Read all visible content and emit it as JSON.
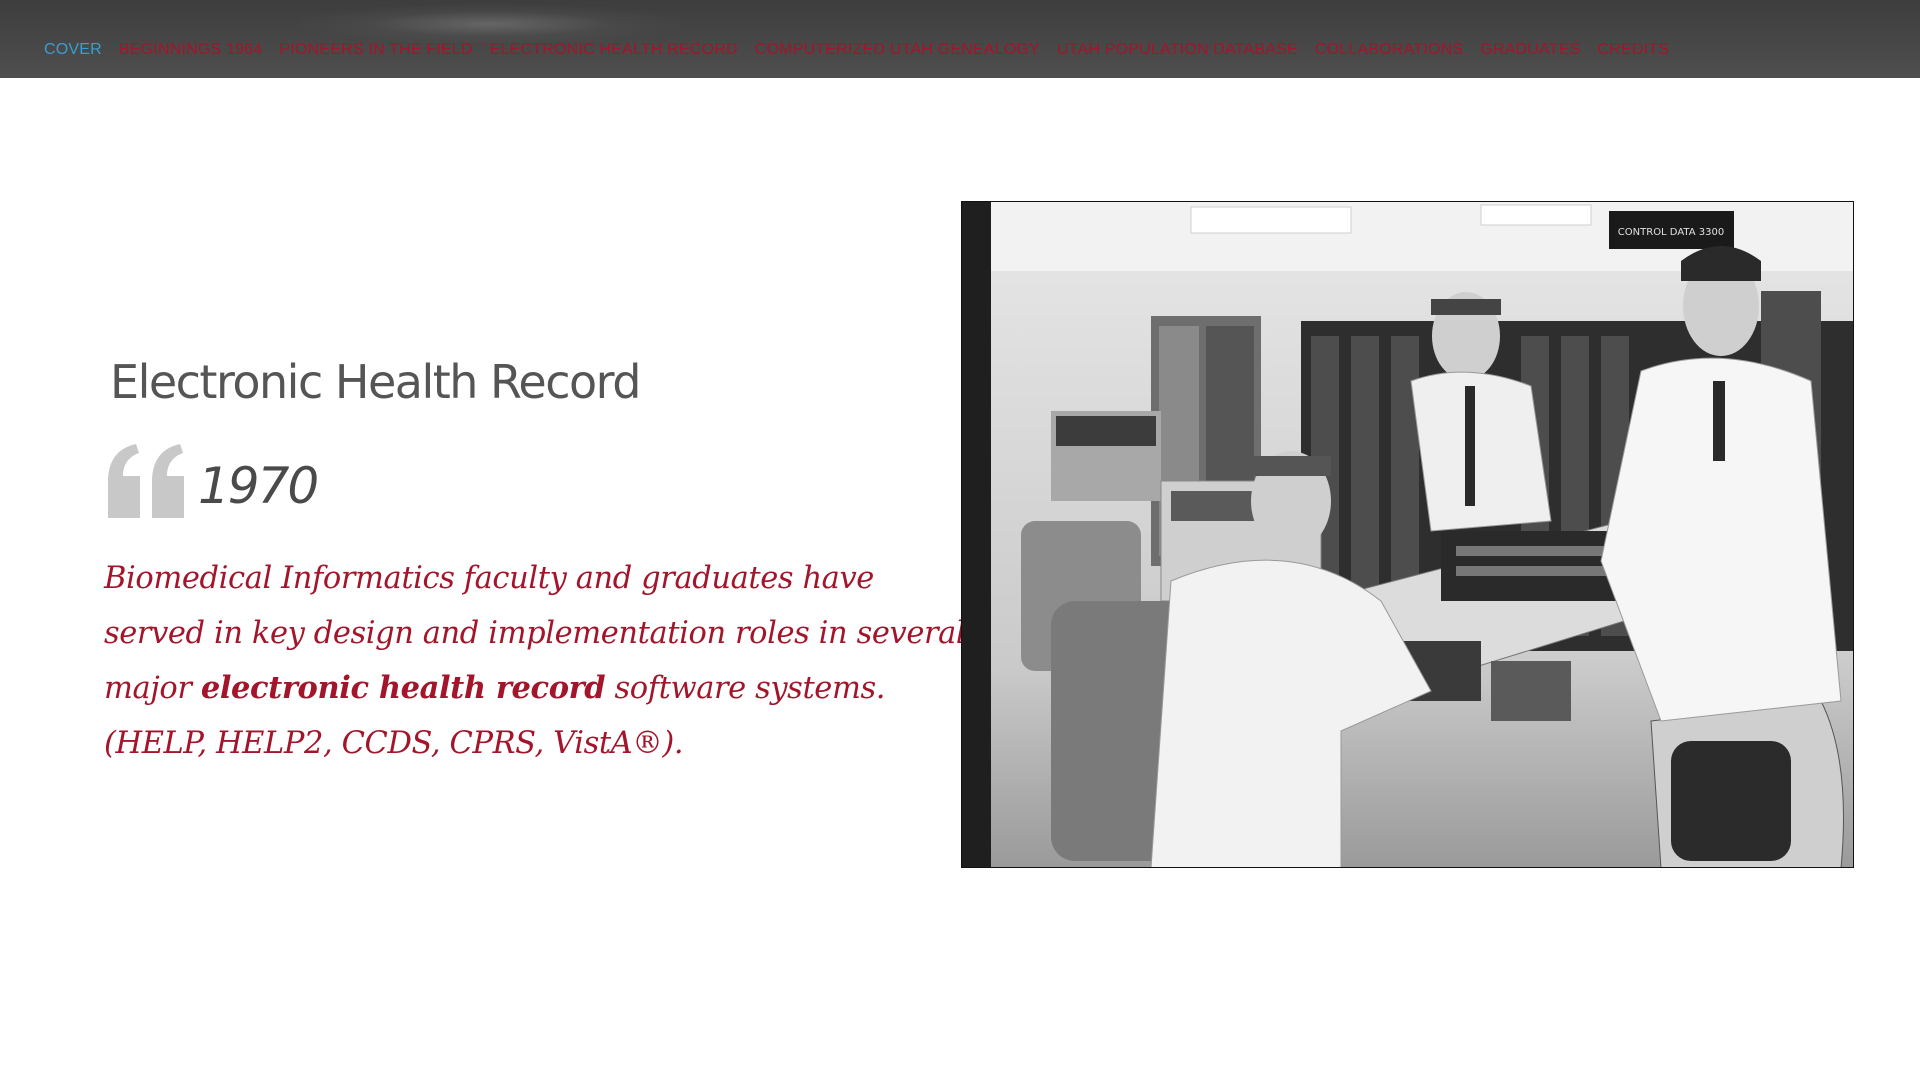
{
  "nav": {
    "items": [
      {
        "label": "COVER",
        "active": true
      },
      {
        "label": "BEGINNINGS 1964",
        "active": false
      },
      {
        "label": "PIONEERS IN THE FIELD",
        "active": false
      },
      {
        "label": "ELECTRONIC HEALTH RECORD",
        "active": false
      },
      {
        "label": "COMPUTERIZED UTAH GENEALOGY",
        "active": false
      },
      {
        "label": "UTAH POPULATION DATABASE",
        "active": false
      },
      {
        "label": "COLLABORATIONS",
        "active": false
      },
      {
        "label": "GRADUATES",
        "active": false
      },
      {
        "label": "CREDITS",
        "active": false
      }
    ]
  },
  "section": {
    "title": "Electronic Health Record",
    "year": "1970",
    "quote_icon": "quote-open-icon",
    "text_part1": "Biomedical Informatics faculty and graduates have",
    "text_part2": "served in key design and implementation roles in several",
    "text_part3a": "major ",
    "text_bold": "electronic health record",
    "text_part3b": " software systems.",
    "text_part4": "(HELP, HELP2, CCDS, CPRS, VistA®)."
  },
  "photo": {
    "subject": "black-and-white-photo-computer-room",
    "sign_text": "CONTROL DATA 3300"
  },
  "colors": {
    "accent_red": "#a3152a",
    "active_blue": "#3a9ed0",
    "heading_gray": "#555555",
    "topbar": "#444444"
  }
}
